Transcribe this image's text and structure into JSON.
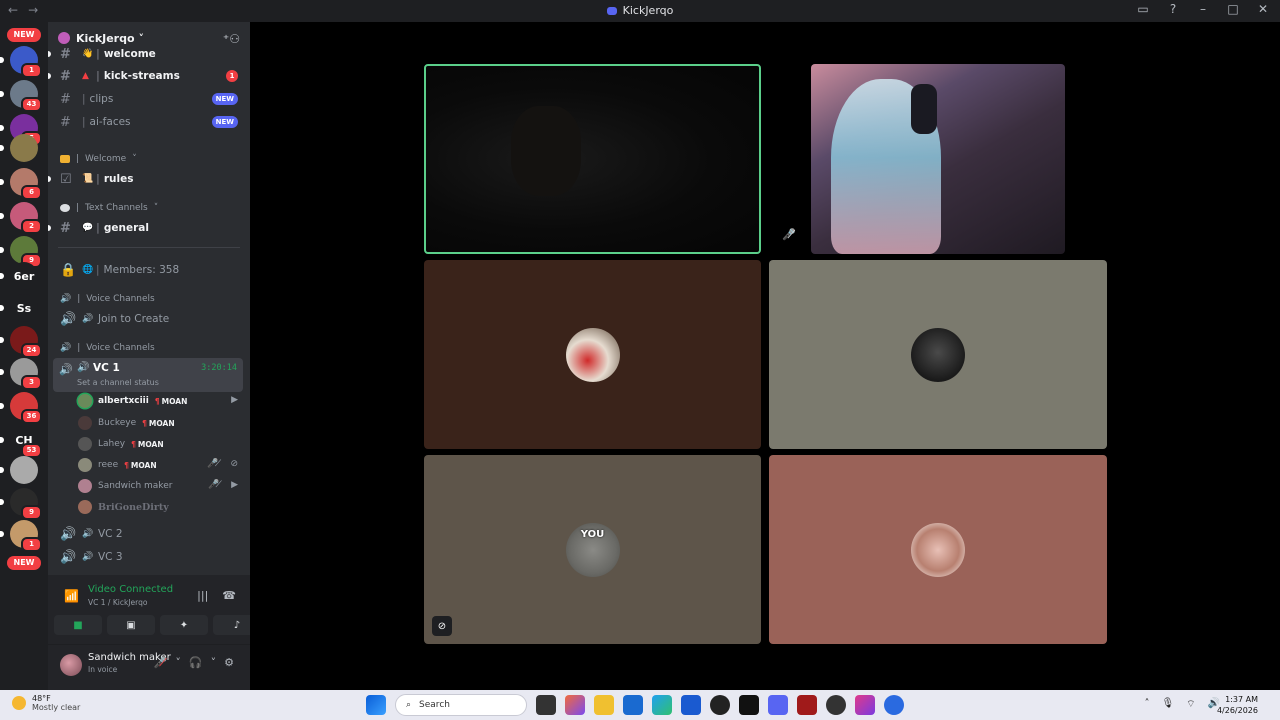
{
  "window": {
    "title": "KickJerqo",
    "nav_back": "←",
    "nav_fwd": "→"
  },
  "servers": [
    {
      "label": "",
      "badge": "1",
      "color": "#3b5ac9"
    },
    {
      "label": "",
      "badge": "43",
      "color": "#6c7a8a"
    },
    {
      "label": "",
      "badge": "5",
      "color": "#7a2f9e"
    },
    {
      "label": "",
      "badge": "",
      "color": "#8a7a4a"
    },
    {
      "label": "",
      "badge": "6",
      "color": "#b47a6a"
    },
    {
      "label": "",
      "badge": "2",
      "color": "#c65a7a"
    },
    {
      "label": "",
      "badge": "9",
      "color": "#5d7a3a"
    },
    {
      "label": "6er",
      "badge": "",
      "color": "#1e1f22"
    },
    {
      "label": "Ss",
      "badge": "",
      "color": "#1e1f22"
    },
    {
      "label": "",
      "badge": "24",
      "color": "#7a1a1a"
    },
    {
      "label": "",
      "badge": "3",
      "color": "#9a9a9a"
    },
    {
      "label": "",
      "badge": "36",
      "color": "#d63a3a"
    },
    {
      "label": "CH",
      "badge": "53",
      "color": "#1e1f22"
    },
    {
      "label": "",
      "badge": "",
      "color": "#aaaaaa"
    },
    {
      "label": "",
      "badge": "9",
      "color": "#2a2a2a"
    },
    {
      "label": "",
      "badge": "1",
      "color": "#c49a6a"
    }
  ],
  "server_new_top": "NEW",
  "server_new_bottom": "NEW",
  "guild": {
    "name": "KickJerqo",
    "chevron": "˅"
  },
  "channels": {
    "welcome": "welcome",
    "kick_streams": "kick-streams",
    "kick_streams_badge": "1",
    "clips": "clips",
    "clips_badge": "NEW",
    "ai_faces": "ai-faces",
    "ai_faces_badge": "NEW",
    "cat_welcome": "Welcome",
    "rules": "rules",
    "cat_text": "Text Channels",
    "general": "general",
    "members": "Members: 358",
    "cat_voice1": "Voice Channels",
    "join_to_create": "Join to Create",
    "cat_voice2": "Voice Channels",
    "vc1": "VC 1",
    "vc1_time": "3:20:14",
    "vc1_status": "Set a channel status",
    "vc2": "VC 2",
    "vc3": "VC 3"
  },
  "voice_members": [
    {
      "name": "albertxciii",
      "tag": "MOAN",
      "color": "#6a8a5a"
    },
    {
      "name": "Buckeye",
      "tag": "MOAN",
      "color": "#4a3a3a"
    },
    {
      "name": "Lahey",
      "tag": "MOAN",
      "color": "#555555"
    },
    {
      "name": "reee",
      "tag": "MOAN",
      "color": "#8a8a7a"
    },
    {
      "name": "Sandwich maker",
      "tag": "",
      "color": "#b08090"
    },
    {
      "name": "BriGoneDirty",
      "tag": "",
      "color": "#9a6a5a"
    }
  ],
  "voice_panel": {
    "connected": "Video Connected",
    "location": "VC 1 / KickJerqo"
  },
  "user": {
    "name": "Sandwich maker",
    "status": "In voice"
  },
  "tiles": {
    "you_label": "YOU"
  },
  "taskbar": {
    "temp": "48°F",
    "weather": "Mostly clear",
    "search": "Search",
    "time": "1:37 AM",
    "date": "4/26/2026"
  }
}
